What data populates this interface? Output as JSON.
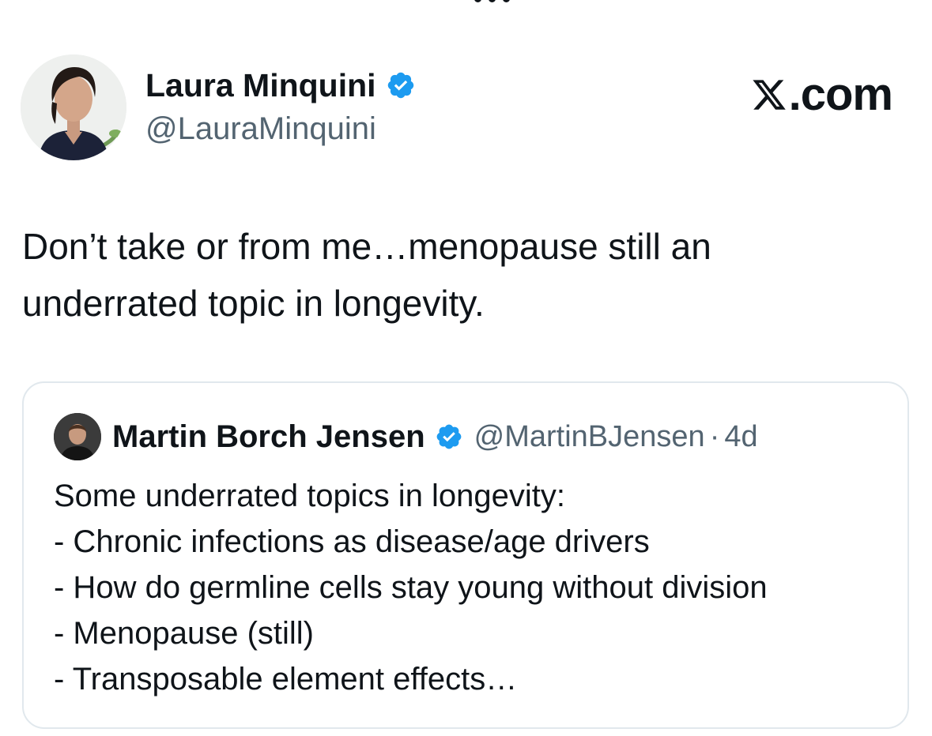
{
  "header": {
    "back_icon": "chevron-icon",
    "more_icon": "ellipsis-icon"
  },
  "author": {
    "display_name": "Laura Minquini",
    "handle": "@LauraMinquini",
    "verified_icon": "verified-badge-icon",
    "avatar_icon": "profile-photo"
  },
  "brand": {
    "label": ".com",
    "logo_icon": "x-logo-icon"
  },
  "tweet": {
    "lines": [
      "Don’t take or from me…menopause still an",
      "underrated topic in longevity."
    ]
  },
  "quoted_tweet": {
    "display_name": "Martin Borch Jensen",
    "handle": "@MartinBJensen",
    "separator": "·",
    "timestamp": "4d",
    "verified_icon": "verified-badge-icon",
    "avatar_icon": "profile-photo",
    "lines": [
      "Some underrated topics in longevity:",
      "- Chronic infections as disease/age drivers",
      "- How do germline cells stay young without division",
      "- Menopause (still)",
      "- Transposable element effects…"
    ]
  },
  "colors": {
    "text": "#0f1419",
    "secondary": "#536471",
    "verified": "#1d9bf0",
    "border": "#e1e8ed"
  }
}
